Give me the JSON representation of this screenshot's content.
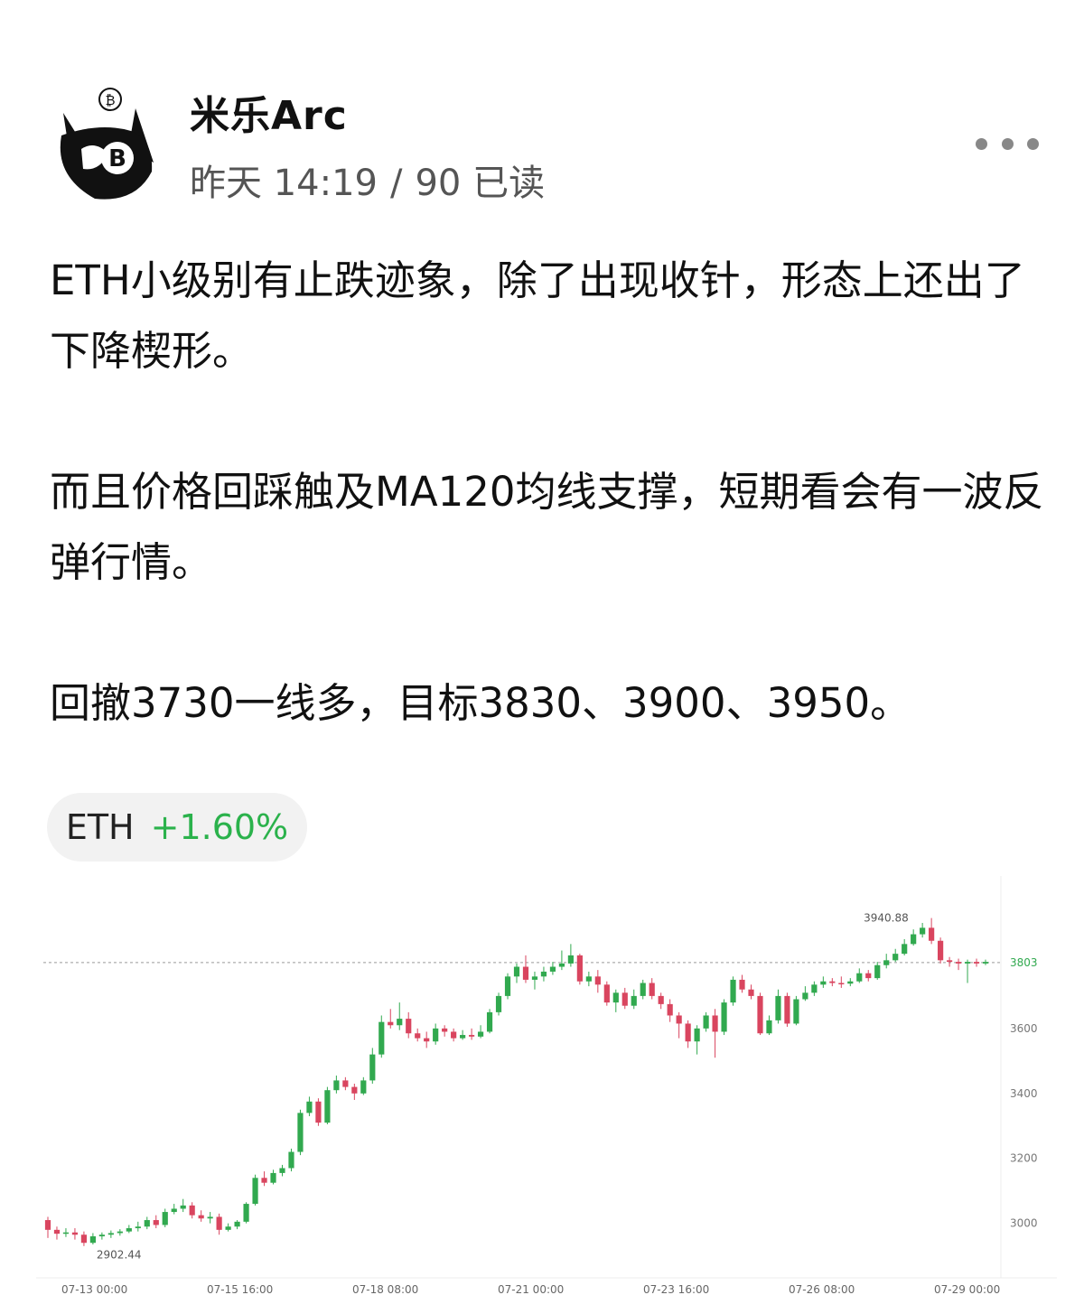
{
  "header": {
    "author_name": "米乐Arc",
    "time": "昨天 14:19",
    "separator": "/",
    "reads": "90 已读",
    "more_icon": "more-dots-icon",
    "avatar_icon": "avatar-rabbit-bitcoin-icon"
  },
  "post": {
    "paragraphs": [
      "ETH小级别有止跌迹象，除了出现收针，形态上还出了下降楔形。",
      "而且价格回踩触及MA120均线支撑，短期看会有一波反弹行情。",
      "回撤3730一线多，目标3830、3900、3950。"
    ]
  },
  "ticker": {
    "symbol": "ETH",
    "change": "+1.60%",
    "change_color": "#2bb24c"
  },
  "chart_data": {
    "type": "candlestick",
    "x_tick_labels": [
      "07-13 00:00",
      "07-15 16:00",
      "07-18 08:00",
      "07-21 00:00",
      "07-23 16:00",
      "07-26 08:00",
      "07-29 00:00"
    ],
    "y_tick_labels": [
      "3000",
      "3200",
      "3400",
      "3600"
    ],
    "ylim": [
      2860,
      4000
    ],
    "current_price_label": "3803",
    "current_price": 3803,
    "annotation_high": "3940.88",
    "annotation_low": "2902.44",
    "up_color": "#31a94f",
    "down_color": "#d9455f",
    "grid": false,
    "candles": [
      [
        3010,
        2980,
        3020,
        2955
      ],
      [
        2980,
        2968,
        2990,
        2950
      ],
      [
        2968,
        2972,
        2985,
        2958
      ],
      [
        2972,
        2965,
        2985,
        2950
      ],
      [
        2965,
        2940,
        2975,
        2930
      ],
      [
        2940,
        2960,
        2970,
        2935
      ],
      [
        2960,
        2965,
        2972,
        2950
      ],
      [
        2965,
        2970,
        2978,
        2955
      ],
      [
        2970,
        2975,
        2982,
        2962
      ],
      [
        2975,
        2985,
        2995,
        2970
      ],
      [
        2985,
        2990,
        3005,
        2975
      ],
      [
        2990,
        3010,
        3020,
        2982
      ],
      [
        3010,
        2995,
        3025,
        2985
      ],
      [
        2995,
        3035,
        3045,
        2988
      ],
      [
        3035,
        3045,
        3060,
        3028
      ],
      [
        3045,
        3055,
        3075,
        3035
      ],
      [
        3055,
        3025,
        3065,
        3015
      ],
      [
        3025,
        3015,
        3040,
        3005
      ],
      [
        3015,
        3020,
        3035,
        3000
      ],
      [
        3020,
        2980,
        3030,
        2965
      ],
      [
        2980,
        2990,
        3000,
        2975
      ],
      [
        2990,
        3005,
        3010,
        2982
      ],
      [
        3005,
        3060,
        3065,
        3000
      ],
      [
        3060,
        3140,
        3150,
        3055
      ],
      [
        3140,
        3125,
        3160,
        3115
      ],
      [
        3125,
        3155,
        3165,
        3120
      ],
      [
        3155,
        3170,
        3180,
        3145
      ],
      [
        3170,
        3220,
        3230,
        3160
      ],
      [
        3220,
        3340,
        3350,
        3210
      ],
      [
        3340,
        3375,
        3390,
        3330
      ],
      [
        3375,
        3310,
        3385,
        3300
      ],
      [
        3310,
        3410,
        3420,
        3305
      ],
      [
        3410,
        3440,
        3455,
        3400
      ],
      [
        3440,
        3420,
        3450,
        3410
      ],
      [
        3420,
        3400,
        3430,
        3380
      ],
      [
        3400,
        3440,
        3450,
        3395
      ],
      [
        3440,
        3520,
        3540,
        3430
      ],
      [
        3520,
        3620,
        3640,
        3510
      ],
      [
        3620,
        3610,
        3660,
        3600
      ],
      [
        3610,
        3630,
        3680,
        3595
      ],
      [
        3630,
        3585,
        3650,
        3570
      ],
      [
        3585,
        3570,
        3600,
        3560
      ],
      [
        3570,
        3560,
        3590,
        3540
      ],
      [
        3560,
        3600,
        3615,
        3550
      ],
      [
        3600,
        3590,
        3610,
        3575
      ],
      [
        3590,
        3570,
        3600,
        3560
      ],
      [
        3570,
        3580,
        3595,
        3565
      ],
      [
        3580,
        3575,
        3600,
        3565
      ],
      [
        3575,
        3590,
        3610,
        3570
      ],
      [
        3590,
        3650,
        3660,
        3585
      ],
      [
        3650,
        3700,
        3710,
        3640
      ],
      [
        3700,
        3760,
        3770,
        3690
      ],
      [
        3760,
        3790,
        3800,
        3740
      ],
      [
        3790,
        3750,
        3825,
        3740
      ],
      [
        3750,
        3760,
        3775,
        3720
      ],
      [
        3760,
        3775,
        3790,
        3745
      ],
      [
        3775,
        3790,
        3805,
        3765
      ],
      [
        3790,
        3800,
        3840,
        3780
      ],
      [
        3800,
        3825,
        3860,
        3790
      ],
      [
        3825,
        3745,
        3830,
        3735
      ],
      [
        3745,
        3760,
        3775,
        3730
      ],
      [
        3760,
        3735,
        3780,
        3710
      ],
      [
        3735,
        3680,
        3745,
        3670
      ],
      [
        3680,
        3710,
        3720,
        3650
      ],
      [
        3710,
        3670,
        3725,
        3660
      ],
      [
        3670,
        3700,
        3720,
        3660
      ],
      [
        3700,
        3740,
        3750,
        3690
      ],
      [
        3740,
        3700,
        3755,
        3690
      ],
      [
        3700,
        3675,
        3710,
        3660
      ],
      [
        3675,
        3640,
        3690,
        3620
      ],
      [
        3640,
        3615,
        3650,
        3570
      ],
      [
        3615,
        3560,
        3625,
        3540
      ],
      [
        3560,
        3600,
        3610,
        3520
      ],
      [
        3600,
        3640,
        3650,
        3590
      ],
      [
        3640,
        3590,
        3660,
        3510
      ],
      [
        3590,
        3680,
        3690,
        3580
      ],
      [
        3680,
        3750,
        3760,
        3670
      ],
      [
        3750,
        3720,
        3765,
        3710
      ],
      [
        3720,
        3700,
        3735,
        3690
      ],
      [
        3700,
        3585,
        3710,
        3580
      ],
      [
        3585,
        3625,
        3640,
        3580
      ],
      [
        3625,
        3700,
        3720,
        3615
      ],
      [
        3700,
        3615,
        3710,
        3605
      ],
      [
        3615,
        3690,
        3700,
        3610
      ],
      [
        3690,
        3710,
        3730,
        3685
      ],
      [
        3710,
        3735,
        3745,
        3700
      ],
      [
        3735,
        3745,
        3760,
        3725
      ],
      [
        3745,
        3740,
        3755,
        3730
      ],
      [
        3740,
        3738,
        3760,
        3725
      ],
      [
        3738,
        3745,
        3755,
        3730
      ],
      [
        3745,
        3770,
        3785,
        3740
      ],
      [
        3770,
        3755,
        3780,
        3745
      ],
      [
        3755,
        3795,
        3805,
        3750
      ],
      [
        3795,
        3810,
        3830,
        3785
      ],
      [
        3810,
        3830,
        3845,
        3805
      ],
      [
        3830,
        3860,
        3875,
        3825
      ],
      [
        3860,
        3890,
        3905,
        3855
      ],
      [
        3890,
        3910,
        3925,
        3880
      ],
      [
        3910,
        3870,
        3940,
        3860
      ],
      [
        3870,
        3810,
        3880,
        3800
      ],
      [
        3810,
        3805,
        3820,
        3790
      ],
      [
        3805,
        3800,
        3815,
        3780
      ],
      [
        3800,
        3805,
        3812,
        3740
      ],
      [
        3805,
        3800,
        3815,
        3790
      ],
      [
        3800,
        3805,
        3812,
        3795
      ]
    ]
  }
}
